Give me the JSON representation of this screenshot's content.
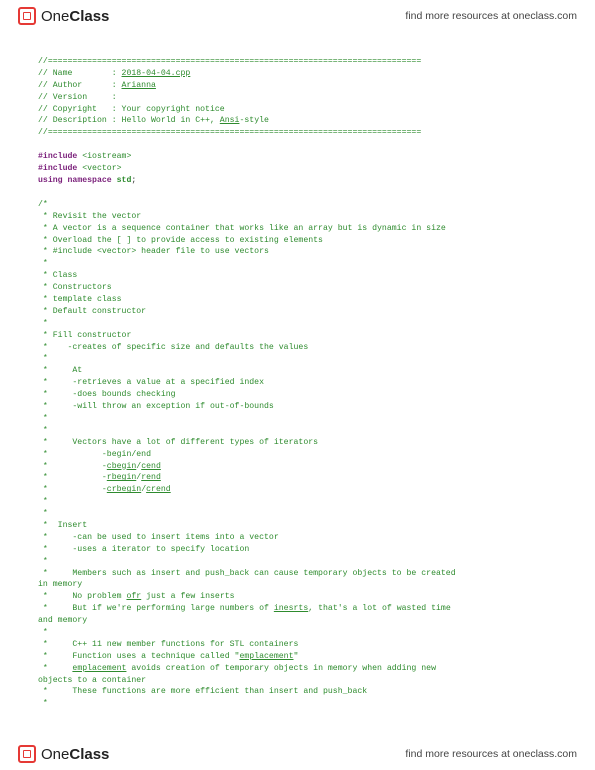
{
  "brand": {
    "one": "One",
    "class": "Class"
  },
  "resources": "find more resources at oneclass.com",
  "code": {
    "sep": "//============================================================================",
    "name_lbl": "// Name        : ",
    "name_val": "2018-04-04.cpp",
    "author_lbl": "// Author      : ",
    "author_val": "Arianna",
    "version_lbl": "// Version     :",
    "copyright": "// Copyright   : Your copyright notice",
    "desc_lbl": "// Description : Hello World in C++, ",
    "desc_ansi": "Ansi",
    "desc_style": "-style",
    "include": "#include",
    "iostream": " <iostream>",
    "vector": " <vector>",
    "using": "using",
    "namespace": " namespace ",
    "std": "std",
    "semi": ";",
    "c01": "/*",
    "c02": " * Revisit the vector",
    "c03": " * A vector is a sequence container that works like an array but is dynamic in size",
    "c04": " * Overload the [ ] to provide access to existing elements",
    "c05": " * #include <vector> header file to use vectors",
    "c06": " *",
    "c07": " * Class",
    "c08": " * Constructors",
    "c09": " * template class",
    "c10": " * Default constructor",
    "c11": " *",
    "c12": " * Fill constructor",
    "c13": " *    -creates of specific size and defaults the values",
    "c14": " *",
    "c15": " *     At",
    "c16": " *     -retrieves a value at a specified index",
    "c17": " *     -does bounds checking",
    "c18": " *     -will throw an exception if out-of-bounds",
    "c19": " *",
    "c20": " *",
    "c21": " *     Vectors have a lot of different types of iterators",
    "c22a": " *           -begin/end",
    "c22b_p": " *           -",
    "c22b_a": "cbegin",
    "c22b_s": "/",
    "c22b_b": "cend",
    "c22c_p": " *           -",
    "c22c_a": "rbegin",
    "c22c_s": "/",
    "c22c_b": "rend",
    "c22d_p": " *           -",
    "c22d_a": "crbegin",
    "c22d_s": "/",
    "c22d_b": "crend",
    "c23": " *",
    "c24": " *",
    "c25": " *  Insert",
    "c26": " *     -can be used to insert items into a vector",
    "c27": " *     -uses a iterator to specify location",
    "c28": " *",
    "c29": " *     Members such as insert and push_back can cause temporary objects to be created",
    "c29b": "in memory",
    "c30a": " *     No problem ",
    "c30u": "ofr",
    "c30b": " just a few inserts",
    "c31a": " *     But if we're performing large numbers of ",
    "c31u": "inesrts",
    "c31b": ", that's a lot of wasted time",
    "c31c": "and memory",
    "c32": " *",
    "c33": " *     C++ 11 new member functions for STL containers",
    "c34a": " *     Function uses a technique called \"",
    "c34u": "emplacement",
    "c34b": "\"",
    "c35a": " *     ",
    "c35u": "emplacement",
    "c35b": " avoids creation of temporary objects in memory when adding new",
    "c35c": "objects to a container",
    "c36": " *     These functions are more efficient than insert and push_back",
    "c37": " *"
  }
}
